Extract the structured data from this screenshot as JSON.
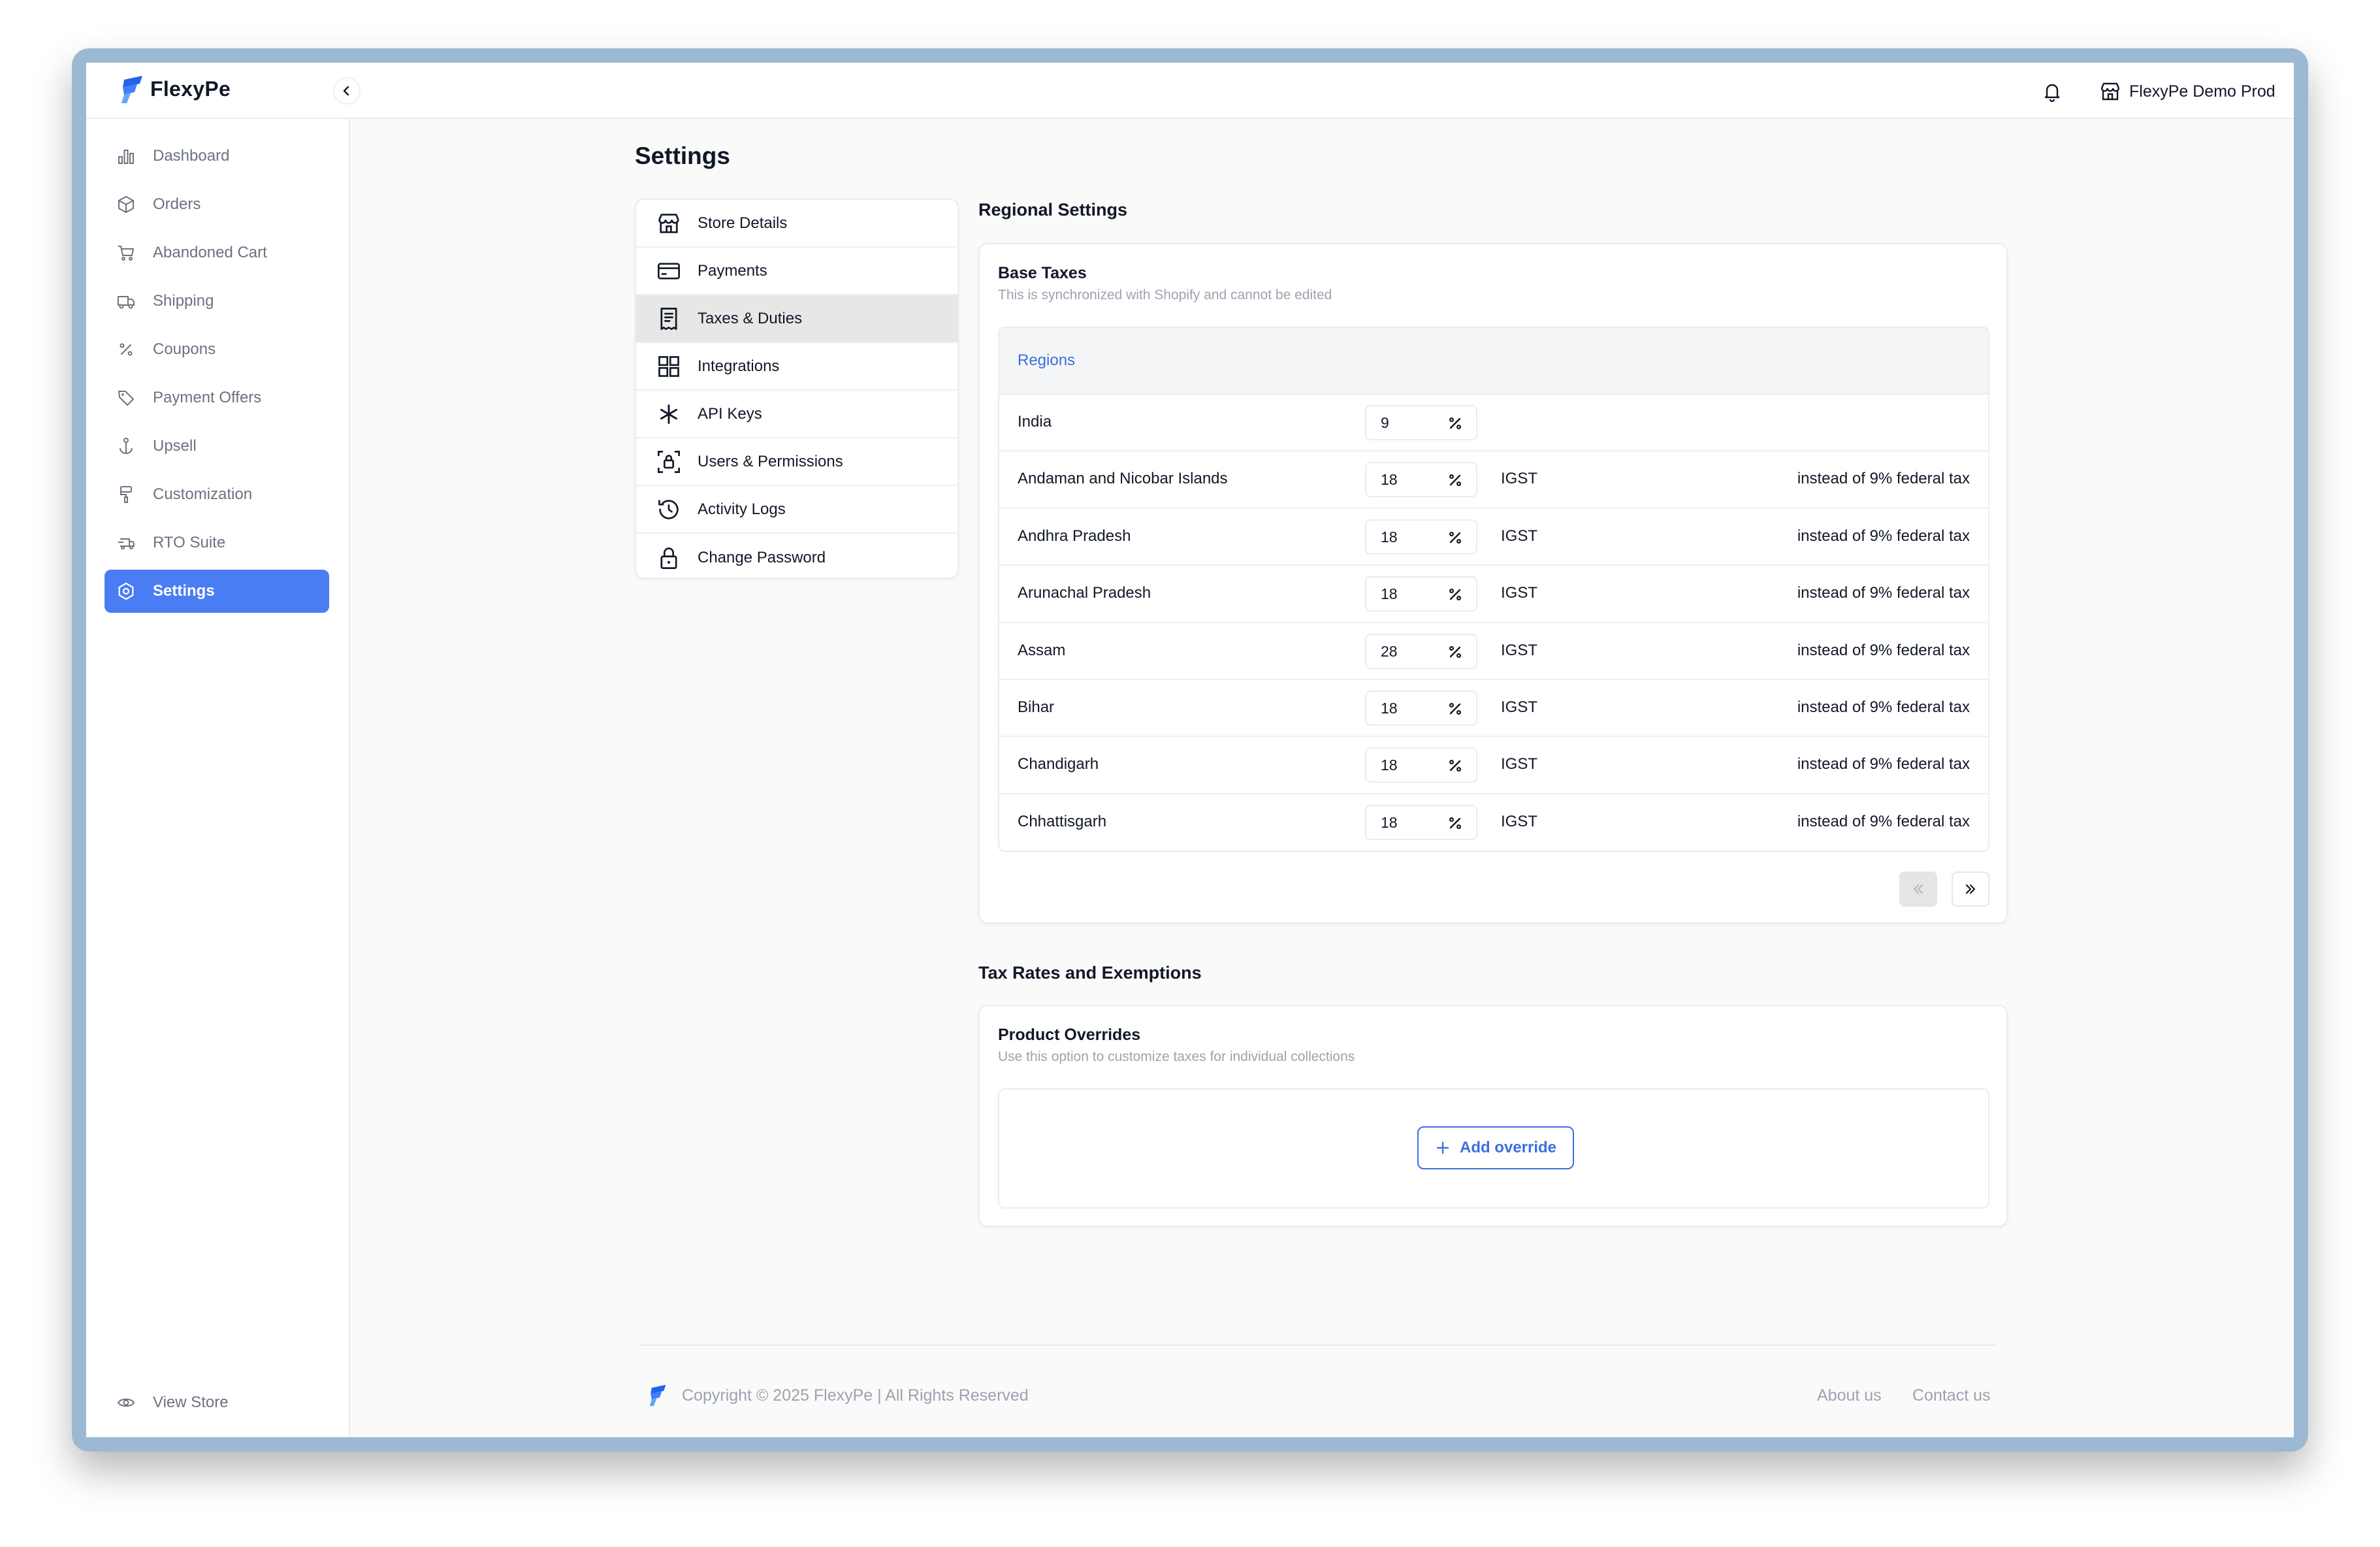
{
  "app": {
    "brand": "FlexyPe",
    "store_name": "FlexyPe Demo Prod",
    "accent_color": "#4a7cf3",
    "link_color": "#3b6fe0"
  },
  "sidebar": {
    "items": [
      {
        "label": "Dashboard",
        "icon": "bar-chart-icon",
        "active": false
      },
      {
        "label": "Orders",
        "icon": "package-icon",
        "active": false
      },
      {
        "label": "Abandoned Cart",
        "icon": "cart-icon",
        "active": false
      },
      {
        "label": "Shipping",
        "icon": "truck-icon",
        "active": false
      },
      {
        "label": "Coupons",
        "icon": "percent-icon",
        "active": false
      },
      {
        "label": "Payment Offers",
        "icon": "tag-icon",
        "active": false
      },
      {
        "label": "Upsell",
        "icon": "anchor-icon",
        "active": false
      },
      {
        "label": "Customization",
        "icon": "paint-roller-icon",
        "active": false
      },
      {
        "label": "RTO Suite",
        "icon": "truck-return-icon",
        "active": false
      },
      {
        "label": "Settings",
        "icon": "gear-icon",
        "active": true
      }
    ],
    "view_store": "View Store"
  },
  "page": {
    "title": "Settings"
  },
  "settings_menu": {
    "items": [
      {
        "label": "Store Details",
        "icon": "store-icon",
        "active": false
      },
      {
        "label": "Payments",
        "icon": "credit-card-icon",
        "active": false
      },
      {
        "label": "Taxes & Duties",
        "icon": "receipt-icon",
        "active": true
      },
      {
        "label": "Integrations",
        "icon": "grid-icon",
        "active": false
      },
      {
        "label": "API Keys",
        "icon": "asterisk-icon",
        "active": false
      },
      {
        "label": "Users & Permissions",
        "icon": "user-lock-icon",
        "active": false
      },
      {
        "label": "Activity Logs",
        "icon": "history-icon",
        "active": false
      },
      {
        "label": "Change Password",
        "icon": "lock-icon",
        "active": false
      }
    ]
  },
  "regional": {
    "section_title": "Regional Settings",
    "card_title": "Base Taxes",
    "card_subtitle": "This is synchronized with Shopify and cannot be edited",
    "table_header": "Regions",
    "rows": [
      {
        "region": "India",
        "rate": "9",
        "type": "",
        "note": ""
      },
      {
        "region": "Andaman and Nicobar Islands",
        "rate": "18",
        "type": "IGST",
        "note": "instead of 9% federal tax"
      },
      {
        "region": "Andhra Pradesh",
        "rate": "18",
        "type": "IGST",
        "note": "instead of 9% federal tax"
      },
      {
        "region": "Arunachal Pradesh",
        "rate": "18",
        "type": "IGST",
        "note": "instead of 9% federal tax"
      },
      {
        "region": "Assam",
        "rate": "28",
        "type": "IGST",
        "note": "instead of 9% federal tax"
      },
      {
        "region": "Bihar",
        "rate": "18",
        "type": "IGST",
        "note": "instead of 9% federal tax"
      },
      {
        "region": "Chandigarh",
        "rate": "18",
        "type": "IGST",
        "note": "instead of 9% federal tax"
      },
      {
        "region": "Chhattisgarh",
        "rate": "18",
        "type": "IGST",
        "note": "instead of 9% federal tax"
      }
    ]
  },
  "exemptions": {
    "section_title": "Tax Rates and Exemptions",
    "card_title": "Product Overrides",
    "card_subtitle": "Use this option to customize taxes for individual collections",
    "add_button": "Add override"
  },
  "footer": {
    "copyright": "Copyright © 2025 FlexyPe | All Rights Reserved",
    "about": "About us",
    "contact": "Contact us"
  }
}
